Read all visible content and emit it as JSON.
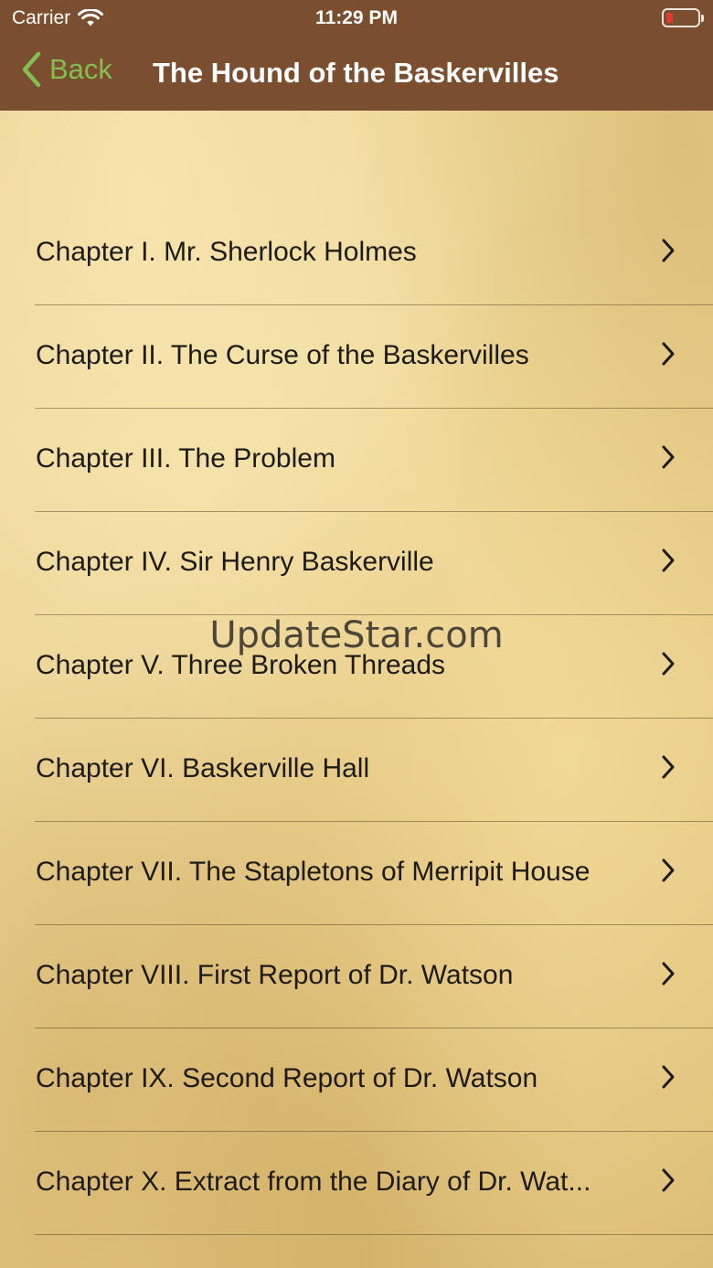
{
  "status_bar": {
    "carrier": "Carrier",
    "time": "11:29 PM",
    "battery_color": "#e53a30"
  },
  "nav_bar": {
    "back_label": "Back",
    "title": "The Hound of the Baskervilles",
    "background_color": "#7a4e2f",
    "accent_color": "#84c050"
  },
  "chapters": [
    {
      "title": "Chapter I. Mr. Sherlock Holmes"
    },
    {
      "title": "Chapter II. The Curse of the Baskervilles"
    },
    {
      "title": "Chapter III. The Problem"
    },
    {
      "title": "Chapter IV. Sir Henry Baskerville"
    },
    {
      "title": "Chapter V. Three Broken Threads"
    },
    {
      "title": "Chapter VI. Baskerville Hall"
    },
    {
      "title": "Chapter VII. The Stapletons of Merripit House"
    },
    {
      "title": "Chapter VIII. First Report of Dr. Watson"
    },
    {
      "title": "Chapter IX. Second Report of Dr. Watson"
    },
    {
      "title": "Chapter X. Extract from the Diary of Dr. Wat..."
    }
  ],
  "watermark": "UpdateStar.com",
  "icons": {
    "wifi": "wifi-icon",
    "battery": "battery-icon",
    "back": "chevron-left-icon",
    "row_disclosure": "chevron-right-icon"
  }
}
